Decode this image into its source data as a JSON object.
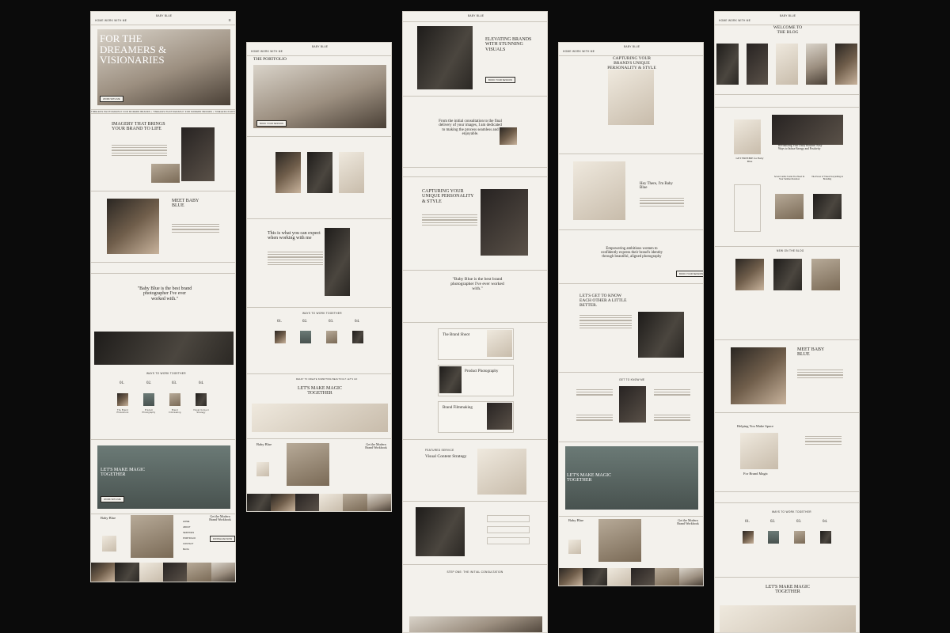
{
  "brand": "BABY BLUE",
  "nav": {
    "left": "HOME  WORK WITH ME",
    "menu_icon": "hamburger-icon"
  },
  "colors": {
    "page_bg": "#f3f1ec",
    "canvas": "#0b0b0b",
    "text": "#2b2925"
  },
  "home": {
    "hero_title": "FOR THE DREAMERS & VISIONARIES",
    "hero_button": "WORK WITH ME",
    "imagery_title": "IMAGERY THAT BRINGS YOUR BRAND TO LIFE",
    "meet_title": "MEET BABY BLUE",
    "quote": "\"Baby Blue is the best brand photographer I've ever worked with.\"",
    "ways_title": "WAYS TO WORK TOGETHER",
    "steps": [
      "01.",
      "02.",
      "03.",
      "04."
    ],
    "step_labels": [
      "The Brand Photoshoot",
      "Product Photography",
      "Brand Filmmaking",
      "Visual Content Strategy"
    ],
    "magic_title": "LET'S MAKE MAGIC TOGETHER",
    "footer_brand": "Baby Blue",
    "footer_menu": [
      "HOME",
      "ABOUT",
      "SERVICES",
      "PORTFOLIO",
      "CONTACT",
      "BLOG"
    ],
    "workbook": "Get the Modern Brand Workbook",
    "workbook_button": "DOWNLOAD NOW"
  },
  "portfolio": {
    "title": "THE PORTFOLIO",
    "button": "BOOK YOUR SESSION",
    "expect_title": "This is what you can expect when working with me",
    "ways_title": "WAYS TO WORK TOGETHER",
    "magic_title": "LET'S MAKE MAGIC TOGETHER",
    "magic_kicker": "READY TO CREATE SOMETHING BEAUTIFUL? LET'S GO",
    "footer_brand": "Baby Blue",
    "workbook": "Get the Modern Brand Workbook"
  },
  "services": {
    "title": "ELEVATING BRANDS WITH STUNNING VISUALS",
    "consult": "From the initial consultation to the final delivery of your images, I am dedicated to making the process seamless and enjoyable.",
    "capture": "CAPTURING YOUR UNIQUE PERSONALITY & STYLE",
    "quote": "\"Baby Blue is the best brand photographer I've ever worked with.\"",
    "cards": [
      "The Brand Shoot",
      "Product Photography",
      "Brand Filmmaking"
    ],
    "card_price": "$400",
    "card_button": "BOOK NOW",
    "featured_kicker": "FEATURED SERVICE",
    "featured": "Visual Content Strategy",
    "step_one": "STEP ONE: THE INITIAL CONSULTATION"
  },
  "about": {
    "title": "CAPTURING YOUR BRAND'S UNIQUE PERSONALITY & STYLE",
    "hey": "Hey There, I'm Baby Blue",
    "mission": "Empowering ambitious women to confidently express their brand's identity through beautiful, aligned photography",
    "know": "LET'S GET TO KNOW EACH OTHER A LITTLE BETTER.",
    "get_to_know": "GET TO KNOW ME",
    "magic_title": "LET'S MAKE MAGIC TOGETHER",
    "footer_brand": "Baby Blue",
    "workbook": "Get the Modern Brand Workbook"
  },
  "blog": {
    "title": "WELCOME TO THE BLOG",
    "freebie": "GET FREEBIE for Baby Blue",
    "post_title": "Revitalizing Your Daily Routine: Easy Ways to Infuse Energy and Positivity",
    "post2": "Seven Candle Scents You Need In Your Summer Rotation",
    "post3": "The Power of Visual Storytelling in Branding",
    "new": "NEW ON THE BLOG",
    "meet": "MEET BABY BLUE",
    "helping": "Helping You Make Space",
    "for_brand": "For Brand Magic",
    "ways_title": "WAYS TO WORK TOGETHER",
    "steps": [
      "01.",
      "02.",
      "03.",
      "04."
    ],
    "magic_title": "LET'S MAKE MAGIC TOGETHER"
  },
  "ticker": "TIMELESS PHOTOGRAPHY FOR MODERN BRANDS • TIMELESS PHOTOGRAPHY FOR MODERN BRANDS • TIMELESS PHOTOGRAPHY FOR MODERN BRANDS • TIMELESS PHOTOGRAPHY FOR MODERN BRANDS"
}
